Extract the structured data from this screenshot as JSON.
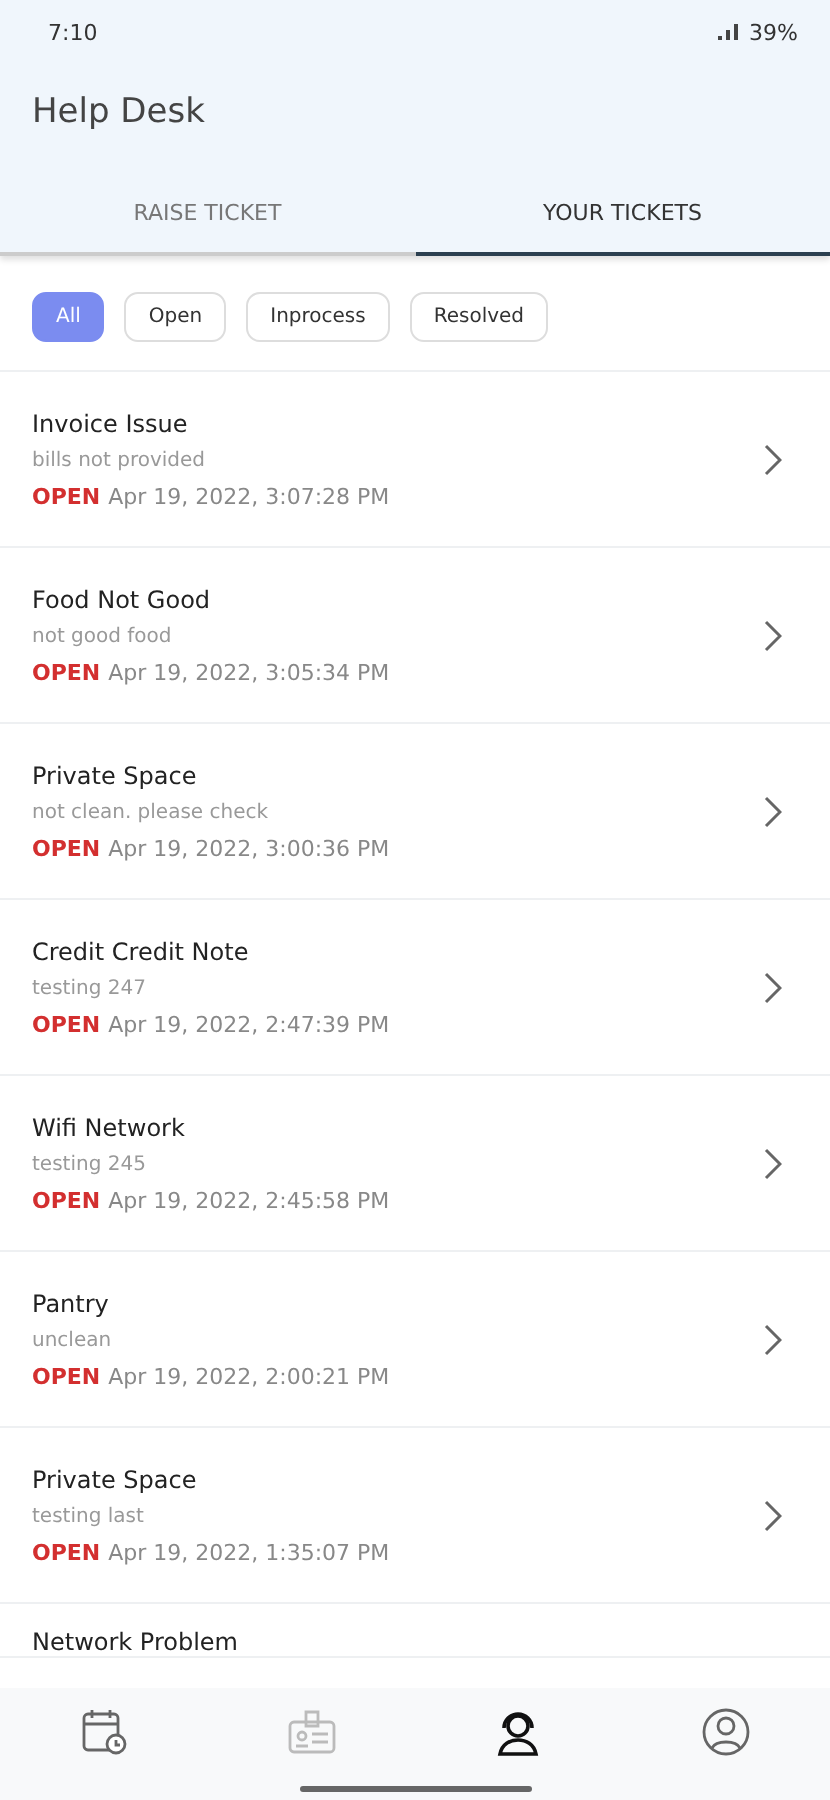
{
  "status_bar": {
    "time": "7:10",
    "battery": "39%"
  },
  "app_bar": {
    "title": "Help Desk"
  },
  "tabs": [
    {
      "label": "RAISE TICKET",
      "selected": false
    },
    {
      "label": "YOUR TICKETS",
      "selected": true
    }
  ],
  "filters": [
    {
      "label": "All",
      "selected": true
    },
    {
      "label": "Open",
      "selected": false
    },
    {
      "label": "Inprocess",
      "selected": false
    },
    {
      "label": "Resolved",
      "selected": false
    }
  ],
  "tickets": [
    {
      "title": "Invoice Issue",
      "description": "bills not provided",
      "status": "OPEN",
      "date": "Apr 19, 2022, 3:07:28 PM"
    },
    {
      "title": "Food Not Good",
      "description": "not good food",
      "status": "OPEN",
      "date": "Apr 19, 2022, 3:05:34 PM"
    },
    {
      "title": "Private Space",
      "description": "not clean. please check",
      "status": "OPEN",
      "date": "Apr 19, 2022, 3:00:36 PM"
    },
    {
      "title": "Credit Credit Note",
      "description": "testing 247",
      "status": "OPEN",
      "date": "Apr 19, 2022, 2:47:39 PM"
    },
    {
      "title": "Wifi Network",
      "description": "testing 245",
      "status": "OPEN",
      "date": "Apr 19, 2022, 2:45:58 PM"
    },
    {
      "title": "Pantry",
      "description": "unclean",
      "status": "OPEN",
      "date": "Apr 19, 2022, 2:00:21 PM"
    },
    {
      "title": "Private Space",
      "description": "testing last",
      "status": "OPEN",
      "date": "Apr 19, 2022, 1:35:07 PM"
    },
    {
      "title": "Network Problem"
    }
  ],
  "bottom_nav": [
    {
      "kind": "calendar",
      "selected": false
    },
    {
      "kind": "badge",
      "selected": false
    },
    {
      "kind": "support",
      "selected": true
    },
    {
      "kind": "profile",
      "selected": false
    }
  ]
}
